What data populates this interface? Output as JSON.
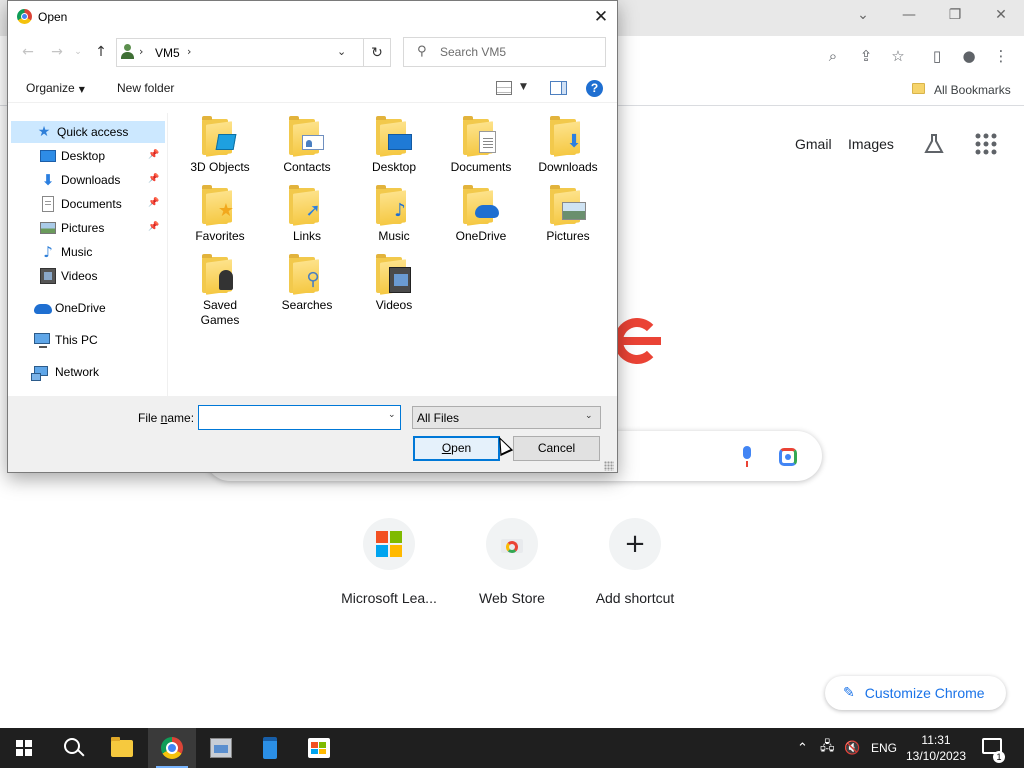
{
  "browser": {
    "bookmarks_bar": {
      "all_bookmarks": "All Bookmarks"
    },
    "toolbar_icons": [
      "zoom-icon",
      "share-icon",
      "star-icon",
      "side-panel-icon",
      "profile-icon",
      "menu-icon"
    ],
    "new_tab": {
      "top_links": {
        "gmail": "Gmail",
        "images": "Images"
      },
      "shortcuts": [
        {
          "label": "Microsoft Lea...",
          "icon": "microsoft-icon"
        },
        {
          "label": "Web Store",
          "icon": "web-store-icon"
        },
        {
          "label": "Add shortcut",
          "icon": "plus-icon"
        }
      ],
      "customize_label": "Customize Chrome"
    }
  },
  "dialog": {
    "title": "Open",
    "address": {
      "segments": [
        "VM5"
      ]
    },
    "search_placeholder": "Search VM5",
    "commands": {
      "organize": "Organize",
      "new_folder": "New folder"
    },
    "nav_items": [
      {
        "label": "Quick access",
        "icon": "star-icon",
        "selected": true
      },
      {
        "label": "Desktop",
        "icon": "desktop-icon",
        "pinned": true
      },
      {
        "label": "Downloads",
        "icon": "download-icon",
        "pinned": true
      },
      {
        "label": "Documents",
        "icon": "document-icon",
        "pinned": true
      },
      {
        "label": "Pictures",
        "icon": "picture-icon",
        "pinned": true
      },
      {
        "label": "Music",
        "icon": "music-icon"
      },
      {
        "label": "Videos",
        "icon": "video-icon"
      },
      {
        "label": "OneDrive",
        "icon": "onedrive-icon"
      },
      {
        "label": "This PC",
        "icon": "pc-icon"
      },
      {
        "label": "Network",
        "icon": "network-icon"
      }
    ],
    "folders": [
      {
        "label": "3D Objects",
        "icon": "3d-objects-folder-icon"
      },
      {
        "label": "Contacts",
        "icon": "contacts-folder-icon"
      },
      {
        "label": "Desktop",
        "icon": "desktop-folder-icon"
      },
      {
        "label": "Documents",
        "icon": "documents-folder-icon"
      },
      {
        "label": "Downloads",
        "icon": "downloads-folder-icon"
      },
      {
        "label": "Favorites",
        "icon": "favorites-folder-icon"
      },
      {
        "label": "Links",
        "icon": "links-folder-icon"
      },
      {
        "label": "Music",
        "icon": "music-folder-icon"
      },
      {
        "label": "OneDrive",
        "icon": "onedrive-folder-icon"
      },
      {
        "label": "Pictures",
        "icon": "pictures-folder-icon"
      },
      {
        "label": "Saved\nGames",
        "icon": "saved-games-folder-icon"
      },
      {
        "label": "Searches",
        "icon": "searches-folder-icon"
      },
      {
        "label": "Videos",
        "icon": "videos-folder-icon"
      }
    ],
    "file_name": {
      "label_pre": "File ",
      "label_underline": "n",
      "label_post": "ame:",
      "value": ""
    },
    "file_type": {
      "selected": "All Files"
    },
    "buttons": {
      "open_underline": "O",
      "open_rest": "pen",
      "cancel": "Cancel"
    }
  },
  "taskbar": {
    "apps": [
      "start-icon",
      "search-icon",
      "file-explorer-icon",
      "chrome-icon",
      "app-icon",
      "notepad-icon",
      "store-icon"
    ],
    "tray": {
      "language": "ENG",
      "time": "11:31",
      "date": "13/10/2023",
      "notifications": "1"
    }
  },
  "colors": {
    "accent": "#0078d7",
    "selection": "#cce8ff",
    "chrome_blue": "#1a73e8",
    "google_red": "#ea4335"
  }
}
